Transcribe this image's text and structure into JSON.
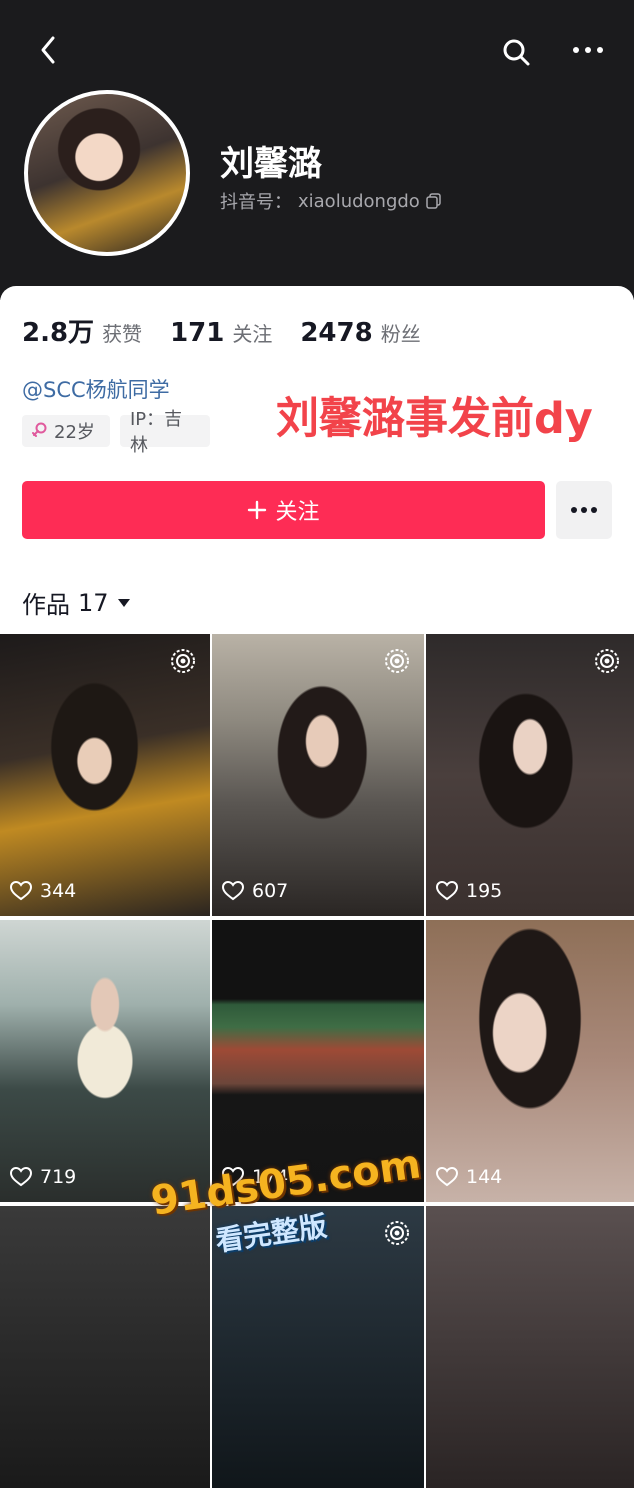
{
  "profile": {
    "name": "刘馨潞",
    "id_label": "抖音号：",
    "id_value": "xiaoludongdo",
    "handle": "@SCC杨航同学",
    "tags": {
      "age": "22岁",
      "ip": "IP：吉林"
    }
  },
  "stats": [
    {
      "value": "2.8万",
      "label": "获赞"
    },
    {
      "value": "171",
      "label": "关注"
    },
    {
      "value": "2478",
      "label": "粉丝"
    }
  ],
  "overlay_caption": "刘馨潞事发前dy",
  "actions": {
    "follow_label": "关注",
    "more_icon": "more-dots-icon"
  },
  "works": {
    "label": "作品",
    "count": "17"
  },
  "grid": [
    {
      "likes": "344",
      "live": true
    },
    {
      "likes": "607",
      "live": true
    },
    {
      "likes": "195",
      "live": true
    },
    {
      "likes": "719",
      "live": false
    },
    {
      "likes": "174",
      "live": false
    },
    {
      "likes": "144",
      "live": false
    },
    {
      "likes": "",
      "live": false
    },
    {
      "likes": "",
      "live": true
    },
    {
      "likes": "",
      "live": false
    }
  ],
  "watermark": {
    "domain": "91ds05.com",
    "sub": "看完整版"
  },
  "colors": {
    "accent": "#fe2c55",
    "handle": "#3e6ba3",
    "overlay": "#f2434a",
    "header_bg": "#1b1b1d"
  }
}
